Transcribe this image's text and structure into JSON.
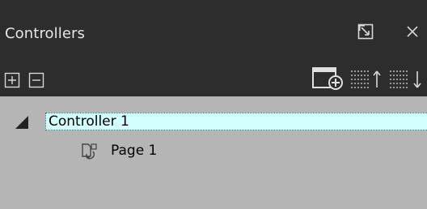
{
  "panel": {
    "title": "Controllers"
  },
  "titlebar_buttons": {
    "restore_icon": "restore-window-icon",
    "close_icon": "close-icon"
  },
  "toolbar": {
    "expand_icon": "plus-box-icon",
    "collapse_icon": "minus-box-icon",
    "add_page_icon": "add-page-icon",
    "sort_ascending_icon": "sort-ascending-icon",
    "sort_descending_icon": "sort-descending-icon"
  },
  "tree": {
    "items": [
      {
        "label": "Controller 1",
        "expanded": true,
        "selected": true,
        "icon": "expanded-triangle-icon"
      },
      {
        "label": "Page 1",
        "icon": "page-icon"
      }
    ]
  },
  "colors": {
    "header_bg": "#2d2d2d",
    "tree_bg": "#b5b5b5",
    "selection_bg": "#d4ffff",
    "icon_color": "#d8d8d8"
  }
}
